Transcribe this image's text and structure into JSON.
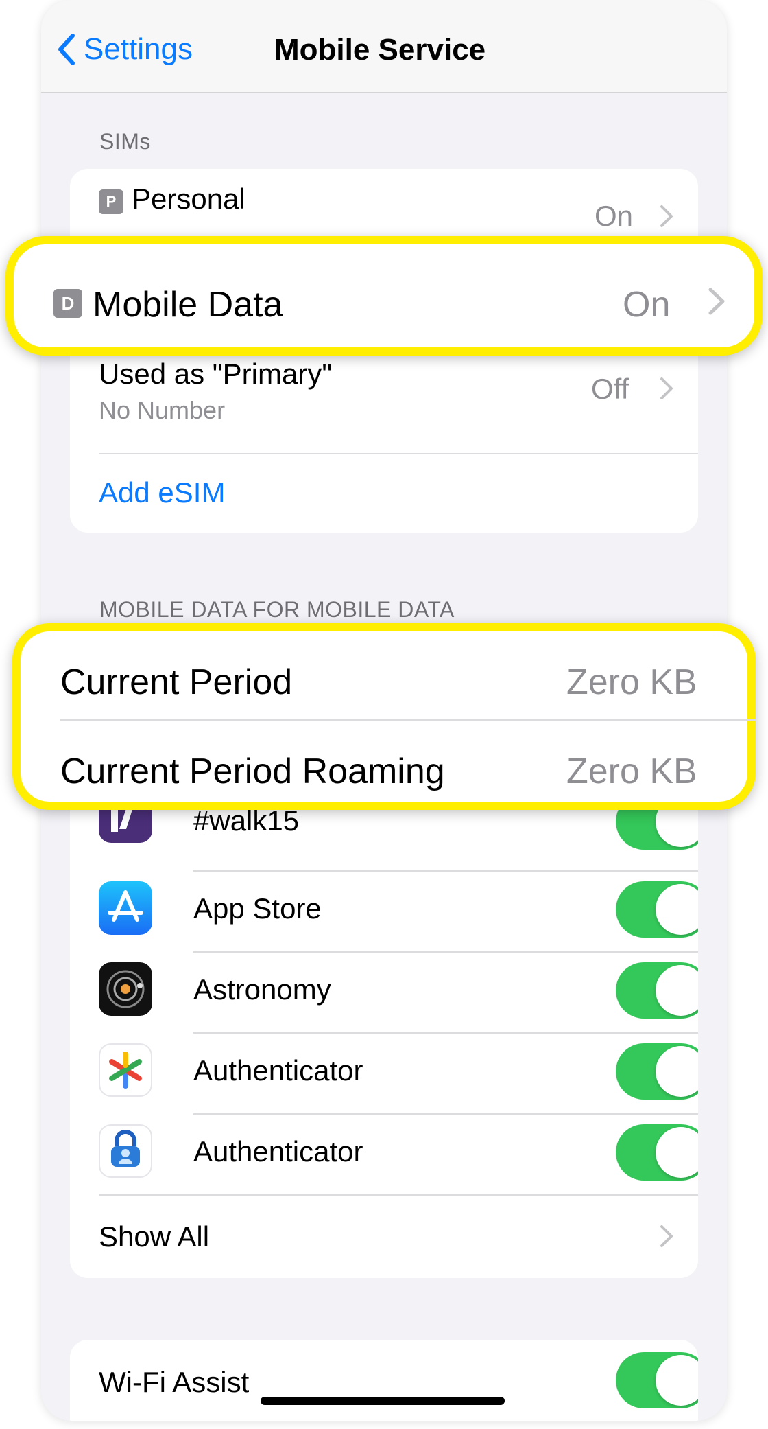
{
  "nav": {
    "back_label": "Settings",
    "title": "Mobile Service"
  },
  "sims": {
    "header": "SIMs",
    "personal": {
      "badge": "P",
      "label": "Personal",
      "value": "On"
    },
    "used_as": {
      "label": "Used as \"Primary\"",
      "sublabel": "No Number",
      "value": "Off"
    },
    "add_esim": "Add eSIM"
  },
  "mobile_data_callout": {
    "badge": "D",
    "label": "Mobile Data",
    "value": "On"
  },
  "usage": {
    "header": "MOBILE DATA FOR MOBILE DATA",
    "rows": [
      {
        "label": "Current Period",
        "value": "Zero KB"
      },
      {
        "label": "Current Period Roaming",
        "value": "Zero KB"
      }
    ]
  },
  "apps": [
    {
      "name": "#walk15",
      "icon": "walk15-icon",
      "enabled": true
    },
    {
      "name": "App Store",
      "icon": "app-store-icon",
      "enabled": true
    },
    {
      "name": "Astronomy",
      "icon": "astronomy-icon",
      "enabled": true
    },
    {
      "name": "Authenticator",
      "icon": "google-authenticator-icon",
      "enabled": true
    },
    {
      "name": "Authenticator",
      "icon": "microsoft-authenticator-icon",
      "enabled": true
    }
  ],
  "show_all": "Show All",
  "wifi_assist": {
    "label": "Wi-Fi Assist",
    "enabled": true
  },
  "colors": {
    "accent": "#0a7aff",
    "toggle_on": "#34c759",
    "highlight": "#ffee00"
  }
}
